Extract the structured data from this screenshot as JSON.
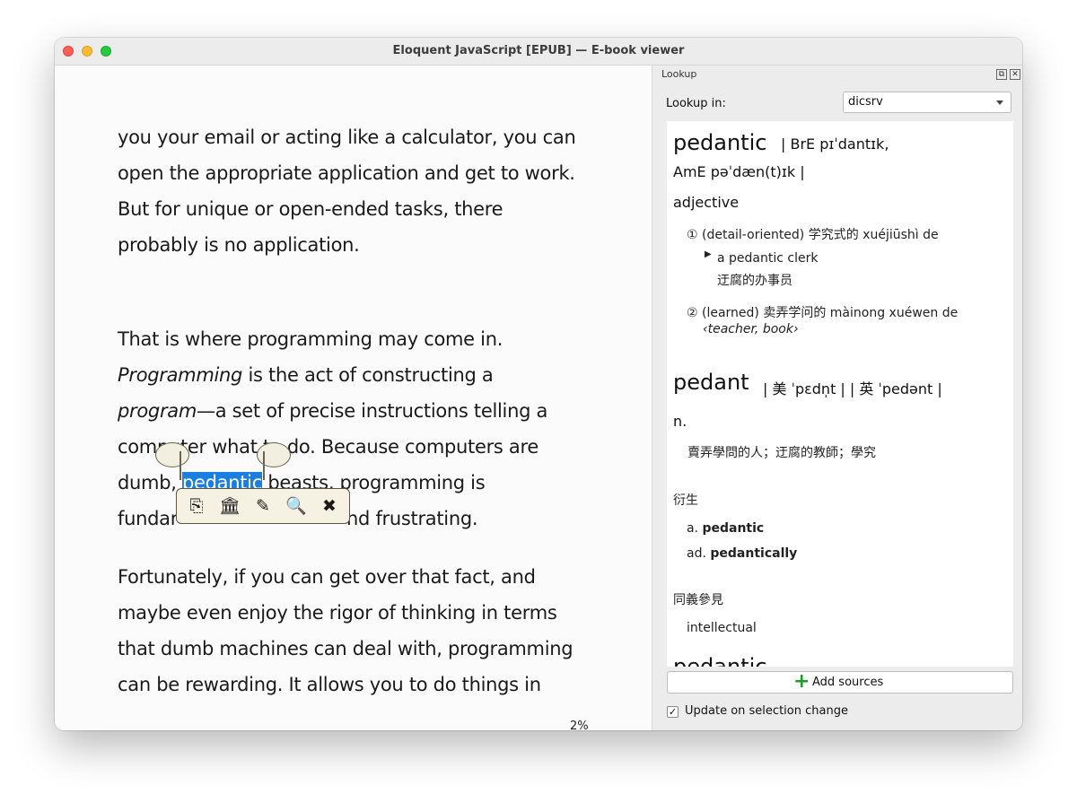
{
  "window": {
    "title": "Eloquent JavaScript [EPUB] — E-book viewer"
  },
  "reader": {
    "paragraph1": [
      "you your email or acting like a calculator, you can",
      "open the appropriate application and get to work.",
      "But for unique or open-ended tasks, there",
      "probably is no application."
    ],
    "paragraph2": {
      "line1": "That is where programming may come in.",
      "line2_em": "Programming",
      "line2_rest": " is the act of constructing a",
      "line3_em": "program",
      "line3_rest": "—a set of precise instructions telling a",
      "line4": "computer what to do. Because computers are",
      "line5_pre": "dumb, ",
      "line5_sel": "pedantic",
      "line5_post": " beasts, programming is",
      "line6_pre": "fundar",
      "line6_post": "nd frustrating."
    },
    "paragraph3": [
      "Fortunately, if you can get over that fact, and",
      "maybe even enjoy the rigor of thinking in terms",
      "that dumb machines can deal with, programming",
      "can be rewarding. It allows you to do things in"
    ],
    "progress": "2%"
  },
  "selection_toolbar": {
    "copy_icon": "⎘",
    "library_icon": "🏛",
    "highlight_icon": "✎",
    "lookup_icon": "🔍",
    "close_icon": "✖"
  },
  "lookup": {
    "panel_title": "Lookup",
    "lookup_in_label": "Lookup in:",
    "source_selected": "dicsrv",
    "entry1": {
      "headword": "pedantic",
      "pron_line1": "| BrE pɪˈdantɪk,",
      "pron_line2": "AmE pəˈdæn(t)ɪk |",
      "pos": "adjective",
      "sense1": "① (detail-oriented) 学究式的  xuéjiūshì de",
      "example1_en": "a pedantic clerk",
      "example1_zh": "迂腐的办事员",
      "sense2": "② (learned) 卖弄学问的  màinong xuéwen de",
      "sense2_note": "‹teacher, book›"
    },
    "entry2": {
      "headword": "pedant",
      "pron": "| 美 ˈpɛdn̩t |   | 英 ˈpedənt |",
      "pos": "n.",
      "definition": "賣弄學問的人；迂腐的教師；學究",
      "derived_heading": "衍生",
      "derived1_pos": "a.",
      "derived1_word": "pedantic",
      "derived2_pos": "ad.",
      "derived2_word": "pedantically",
      "synonym_heading": "同義參見",
      "synonym1": "intellectual"
    },
    "add_sources_label": "Add sources",
    "update_label": "Update on selection change",
    "update_checked": true
  }
}
